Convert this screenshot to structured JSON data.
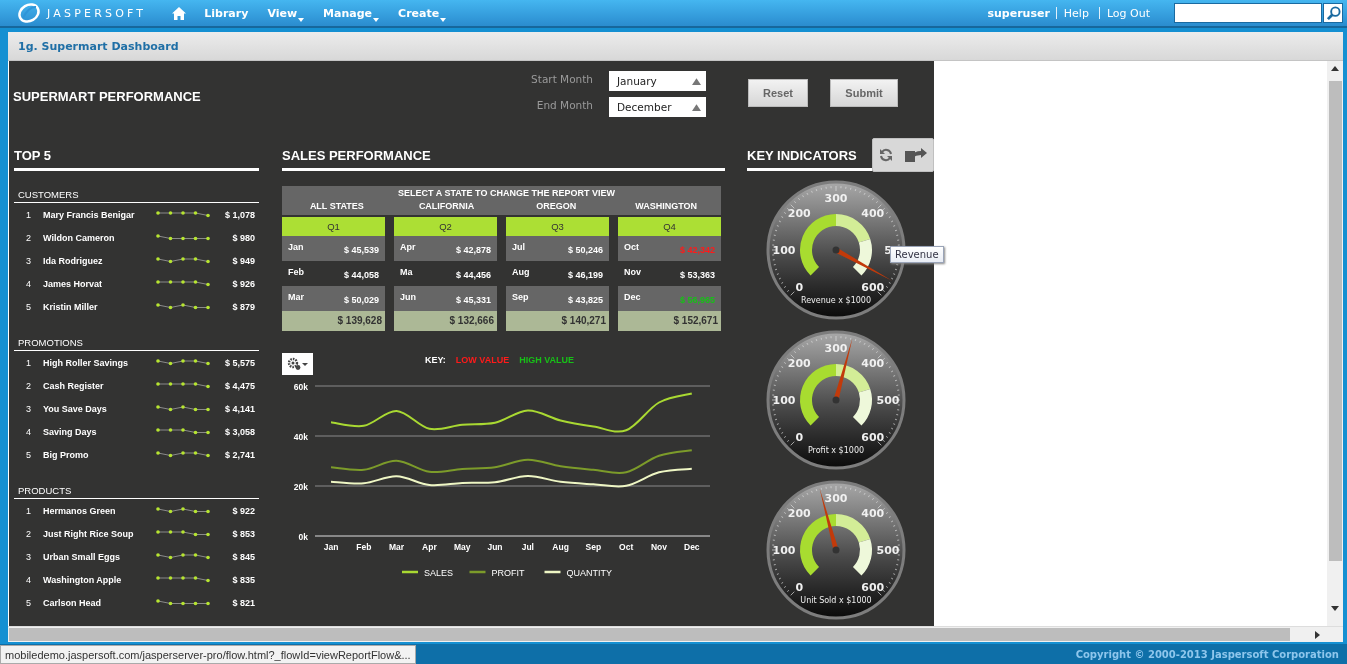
{
  "nav": {
    "logo": "JASPERSOFT",
    "menu": [
      {
        "label": "Library",
        "dropdown": false
      },
      {
        "label": "View",
        "dropdown": true
      },
      {
        "label": "Manage",
        "dropdown": true
      },
      {
        "label": "Create",
        "dropdown": true
      }
    ],
    "user": "superuser",
    "links": [
      "Help",
      "Log Out"
    ]
  },
  "page_title": "1g. Supermart Dashboard",
  "dashboard": {
    "title": "SUPERMART PERFORMANCE",
    "filters": [
      {
        "label": "Start Month",
        "value": "January"
      },
      {
        "label": "End Month",
        "value": "December"
      }
    ],
    "buttons": [
      "Reset",
      "Submit"
    ],
    "top5": {
      "title": "TOP 5",
      "sections": [
        {
          "title": "CUSTOMERS",
          "rows": [
            {
              "rank": "1",
              "name": "Mary Francis Benigar",
              "amount": "$ 1,078"
            },
            {
              "rank": "2",
              "name": "Wildon Cameron",
              "amount": "$ 980"
            },
            {
              "rank": "3",
              "name": "Ida Rodriguez",
              "amount": "$ 949"
            },
            {
              "rank": "4",
              "name": "James Horvat",
              "amount": "$ 926"
            },
            {
              "rank": "5",
              "name": "Kristin Miller",
              "amount": "$ 879"
            }
          ]
        },
        {
          "title": "PROMOTIONS",
          "rows": [
            {
              "rank": "1",
              "name": "High Roller Savings",
              "amount": "$ 5,575"
            },
            {
              "rank": "2",
              "name": "Cash Register",
              "amount": "$ 4,475"
            },
            {
              "rank": "3",
              "name": "You Save Days",
              "amount": "$ 4,141"
            },
            {
              "rank": "4",
              "name": "Saving Days",
              "amount": "$ 3,058"
            },
            {
              "rank": "5",
              "name": "Big Promo",
              "amount": "$ 2,741"
            }
          ]
        },
        {
          "title": "PRODUCTS",
          "rows": [
            {
              "rank": "1",
              "name": "Hermanos Green",
              "amount": "$ 922"
            },
            {
              "rank": "2",
              "name": "Just Right Rice Soup",
              "amount": "$ 853"
            },
            {
              "rank": "3",
              "name": "Urban Small Eggs",
              "amount": "$ 845"
            },
            {
              "rank": "4",
              "name": "Washington Apple",
              "amount": "$ 835"
            },
            {
              "rank": "5",
              "name": "Carlson Head",
              "amount": "$ 821"
            }
          ]
        }
      ]
    },
    "sales": {
      "title": "SALES PERFORMANCE",
      "prompt": "SELECT A STATE TO CHANGE THE REPORT VIEW",
      "states": [
        "ALL STATES",
        "CALIFORNIA",
        "OREGON",
        "WASHINGTON"
      ],
      "quarters": [
        {
          "label": "Q1",
          "months": [
            {
              "month": "Jan",
              "value": "$ 45,539",
              "low": false,
              "high": false
            },
            {
              "month": "Feb",
              "value": "$ 44,058",
              "low": false,
              "high": false
            },
            {
              "month": "Mar",
              "value": "$ 50,029",
              "low": false,
              "high": false
            }
          ],
          "total": "$ 139,628"
        },
        {
          "label": "Q2",
          "months": [
            {
              "month": "Apr",
              "value": "$ 42,878",
              "low": false,
              "high": false
            },
            {
              "month": "Ma",
              "value": "$ 44,456",
              "low": false,
              "high": false
            },
            {
              "month": "Jun",
              "value": "$ 45,331",
              "low": false,
              "high": false
            }
          ],
          "total": "$ 132,666"
        },
        {
          "label": "Q3",
          "months": [
            {
              "month": "Jul",
              "value": "$ 50,246",
              "low": false,
              "high": false
            },
            {
              "month": "Aug",
              "value": "$ 46,199",
              "low": false,
              "high": false
            },
            {
              "month": "Sep",
              "value": "$ 43,825",
              "low": false,
              "high": false
            }
          ],
          "total": "$ 140,271"
        },
        {
          "label": "Q4",
          "months": [
            {
              "month": "Oct",
              "value": "$ 42,342",
              "low": true,
              "high": false
            },
            {
              "month": "Nov",
              "value": "$ 53,363",
              "low": false,
              "high": false
            },
            {
              "month": "Dec",
              "value": "$ 56,965",
              "low": false,
              "high": true
            }
          ],
          "total": "$ 152,671"
        }
      ],
      "key": {
        "label": "KEY:",
        "low": "LOW VALUE",
        "high": "HIGH VALUE"
      },
      "chart_data": {
        "type": "line",
        "categories": [
          "Jan",
          "Feb",
          "Mar",
          "Apr",
          "May",
          "Jun",
          "Jul",
          "Aug",
          "Sep",
          "Oct",
          "Nov",
          "Dec"
        ],
        "series": [
          {
            "name": "SALES",
            "color": "#a9d932",
            "values": [
              45500,
              44100,
              50000,
              42900,
              44500,
              45300,
              50200,
              46200,
              43800,
              42300,
              53400,
              57000
            ]
          },
          {
            "name": "PROFIT",
            "color": "#7c9b2a",
            "values": [
              27500,
              26500,
              30100,
              25700,
              26800,
              27500,
              30500,
              27900,
              26500,
              25500,
              32100,
              34300
            ]
          },
          {
            "name": "QUANTITY",
            "color": "#eef6c4",
            "values": [
              21700,
              21100,
              23900,
              20400,
              21200,
              21500,
              24000,
              21700,
              20700,
              20100,
              25500,
              26900
            ]
          }
        ],
        "ylim": [
          0,
          60000
        ],
        "legend": "bottom",
        "yticks": [
          {
            "value": 0,
            "label": "0k"
          },
          {
            "value": 20000,
            "label": "20k"
          },
          {
            "value": 40000,
            "label": "40k"
          },
          {
            "value": 60000,
            "label": "60k"
          }
        ]
      }
    },
    "indicators": {
      "title": "KEY INDICATORS",
      "tooltip": "Revenue",
      "gauges": [
        {
          "caption": "Revenue x $1000",
          "ticks": [
            "0",
            "100",
            "200",
            "300",
            "400",
            "5",
            "600"
          ],
          "level": 0.94
        },
        {
          "caption": "Profit x $1000",
          "ticks": [
            "0",
            "100",
            "200",
            "300",
            "400",
            "500",
            "600"
          ],
          "level": 0.555
        },
        {
          "caption": "Unit Sold x $1000",
          "ticks": [
            "0",
            "100",
            "200",
            "300",
            "400",
            "500",
            "600"
          ],
          "level": 0.445
        }
      ]
    }
  },
  "status_url": "mobiledemo.jaspersoft.com/jasperserver-pro/flow.html?_flowId=viewReportFlow&...",
  "copyright": "Copyright © 2000-2013 Jaspersoft Corporation"
}
